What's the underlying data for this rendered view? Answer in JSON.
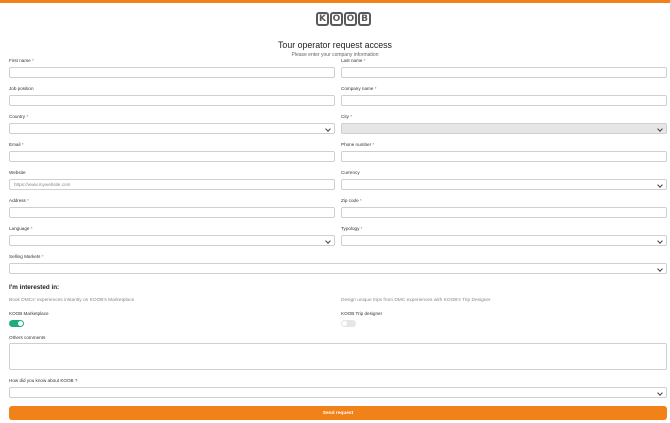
{
  "brand": {
    "logo_letters": [
      "K",
      "O",
      "O",
      "B"
    ],
    "accent_color": "#f08219",
    "toggle_on_color": "#1fae7a"
  },
  "header": {
    "title": "Tour operator request access",
    "subtitle": "Please enter your company information"
  },
  "form": {
    "required_mark": "*",
    "first_name": {
      "label": "First name",
      "value": ""
    },
    "last_name": {
      "label": "Last name",
      "value": ""
    },
    "job_position": {
      "label": "Job position",
      "value": ""
    },
    "company_name": {
      "label": "Company name",
      "value": ""
    },
    "country": {
      "label": "Country",
      "value": ""
    },
    "city": {
      "label": "City",
      "value": ""
    },
    "email": {
      "label": "Email",
      "value": ""
    },
    "phone_number": {
      "label": "Phone number",
      "value": ""
    },
    "website": {
      "label": "Website",
      "placeholder": "https://www.mywebsite.com"
    },
    "currency": {
      "label": "Currency",
      "value": ""
    },
    "address": {
      "label": "Address",
      "value": ""
    },
    "zip_code": {
      "label": "Zip code",
      "value": ""
    },
    "language": {
      "label": "Language",
      "value": ""
    },
    "typology": {
      "label": "Typology",
      "value": ""
    },
    "selling_markets": {
      "label": "Selling Markets",
      "value": ""
    }
  },
  "interests": {
    "title": "I'm interested in:",
    "marketplace": {
      "description": "Book DMCs' experiences instantly on KOOB's Marketplace",
      "label": "KOOB Marketplace",
      "enabled": true
    },
    "trip_designer": {
      "description": "Design unique trips from DMC experiences with KOOB's Trip Designer",
      "label": "KOOB Trip designer",
      "enabled": false
    }
  },
  "comments": {
    "label": "Others comments"
  },
  "referral": {
    "label": "How did you know about KOOB ?"
  },
  "submit": {
    "label": "Send request"
  }
}
